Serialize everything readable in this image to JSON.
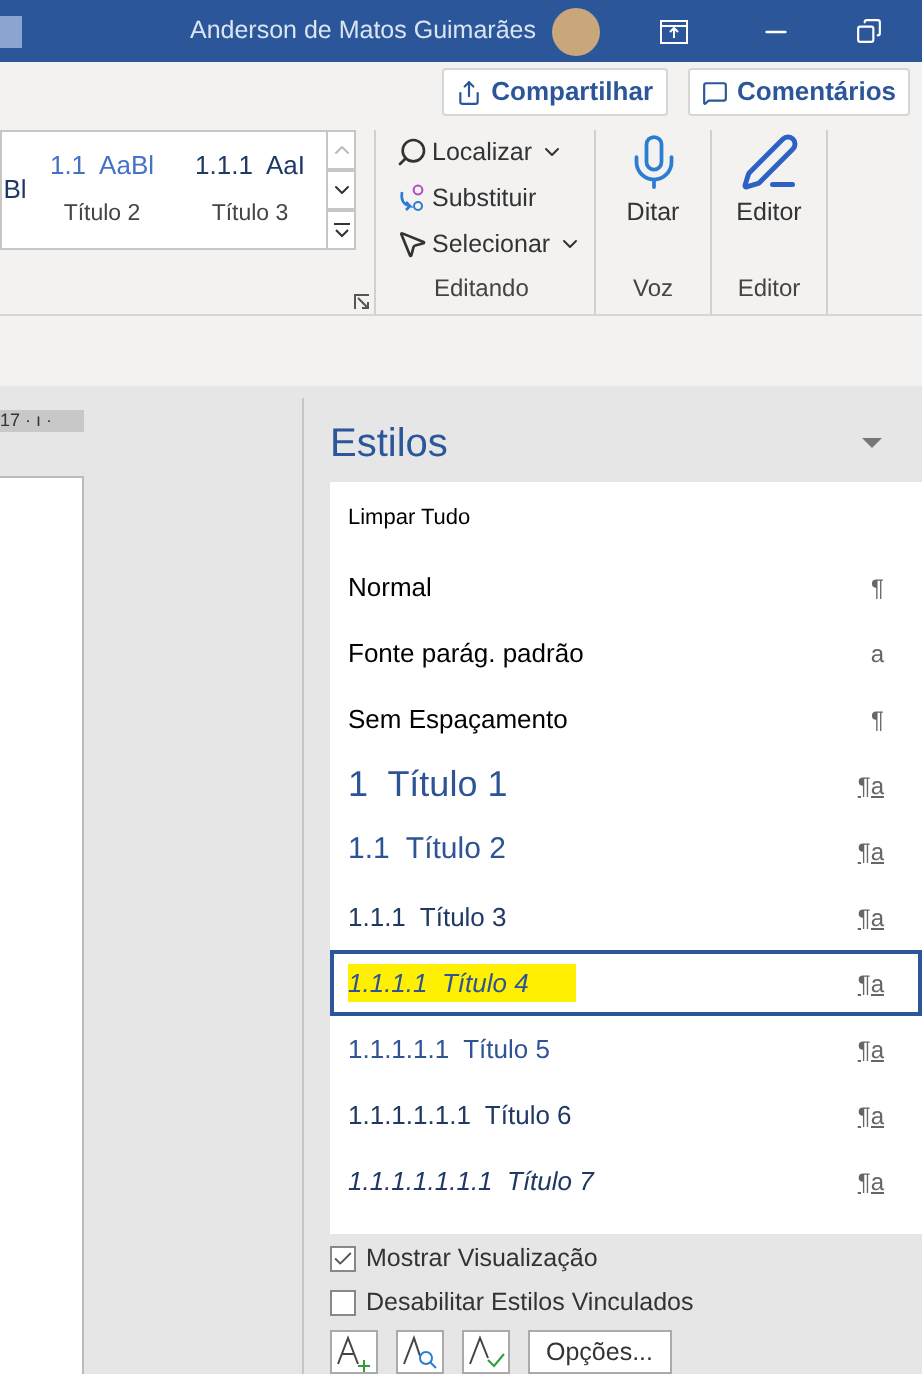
{
  "title_bar": {
    "user_name": "Anderson de Matos Guimarães"
  },
  "header_buttons": [
    {
      "kind": "share",
      "label": "Compartilhar"
    },
    {
      "kind": "comments",
      "label": "Comentários"
    }
  ],
  "ribbon": {
    "gallery": [
      {
        "preview": "Bl"
      },
      {
        "preview": "1.1  AaBl",
        "label": "Título 2"
      },
      {
        "preview": "1.1.1  AaI",
        "label": "Título 3"
      }
    ],
    "editing": {
      "items": [
        {
          "kind": "find",
          "label": "Localizar",
          "dropdown": true
        },
        {
          "kind": "replace",
          "label": "Substituir",
          "dropdown": false
        },
        {
          "kind": "select",
          "label": "Selecionar",
          "dropdown": true
        }
      ],
      "group_label": "Editando"
    },
    "voice": {
      "button": "Ditar",
      "group_label": "Voz"
    },
    "editor": {
      "button": "Editor",
      "group_label": "Editor"
    }
  },
  "ruler": {
    "text": "17 · ı ·"
  },
  "styles_pane": {
    "title": "Estilos",
    "items": [
      {
        "label": "Limpar Tudo",
        "kind": "clear",
        "selected": false,
        "highlighted": false
      },
      {
        "label": "Normal",
        "kind": "plain",
        "mark": "¶",
        "selected": false,
        "highlighted": false
      },
      {
        "label": "Fonte parág. padrão",
        "kind": "plain",
        "mark": "a",
        "selected": false,
        "highlighted": false
      },
      {
        "label": "Sem Espaçamento",
        "kind": "plain",
        "mark": "¶",
        "selected": false,
        "highlighted": false
      },
      {
        "label": "1  Título 1",
        "kind": "heading1",
        "mark": "¶a",
        "selected": false,
        "highlighted": false
      },
      {
        "label": "1.1  Título 2",
        "kind": "heading2",
        "mark": "¶a",
        "selected": false,
        "highlighted": false
      },
      {
        "label": "1.1.1  Título 3",
        "kind": "heading3",
        "mark": "¶a",
        "selected": false,
        "highlighted": false
      },
      {
        "label": "1.1.1.1  Título 4",
        "kind": "heading4",
        "mark": "¶a",
        "selected": true,
        "highlighted": true
      },
      {
        "label": "1.1.1.1.1  Título 5",
        "kind": "heading5",
        "mark": "¶a",
        "selected": false,
        "highlighted": false
      },
      {
        "label": "1.1.1.1.1.1  Título 6",
        "kind": "heading6",
        "mark": "¶a",
        "selected": false,
        "highlighted": false
      },
      {
        "label": "1.1.1.1.1.1.1  Título 7",
        "kind": "heading7",
        "mark": "¶a",
        "selected": false,
        "highlighted": false
      }
    ],
    "options": [
      {
        "label": "Mostrar Visualização",
        "checked": true
      },
      {
        "label": "Desabilitar Estilos Vinculados",
        "checked": false
      }
    ],
    "footer_button": "Opções..."
  }
}
